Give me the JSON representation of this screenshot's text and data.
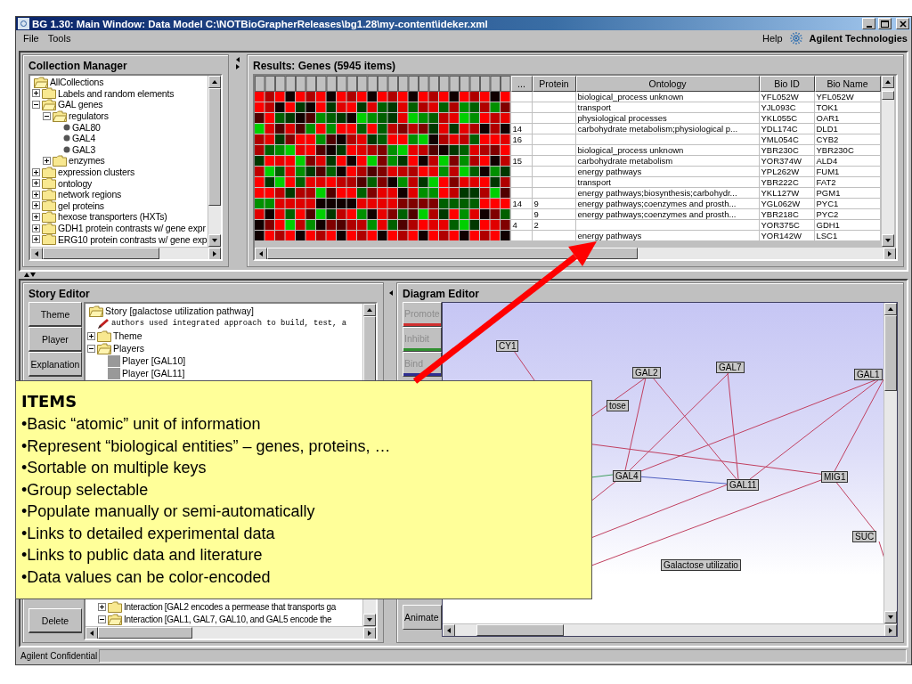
{
  "window": {
    "title": "BG 1.30: Main Window: Data Model C:\\NOTBioGrapherReleases\\bg1.28\\my-content\\ideker.xml"
  },
  "menu": [
    "File",
    "Tools"
  ],
  "menu_right": {
    "help": "Help",
    "brand": "Agilent Technologies"
  },
  "collection_manager": {
    "title": "Collection Manager",
    "tree": [
      {
        "label": "AllCollections",
        "kind": "root",
        "children": [
          {
            "label": "Labels and random elements",
            "kind": "folder",
            "expanded": false
          },
          {
            "label": "GAL genes",
            "kind": "folder",
            "expanded": true,
            "children": [
              {
                "label": "regulators",
                "kind": "folder",
                "expanded": true,
                "children": [
                  {
                    "label": "GAL80",
                    "kind": "gene"
                  },
                  {
                    "label": "GAL4",
                    "kind": "gene"
                  },
                  {
                    "label": "GAL3",
                    "kind": "gene"
                  }
                ]
              },
              {
                "label": "enzymes",
                "kind": "folder",
                "expanded": false
              }
            ]
          },
          {
            "label": "expression clusters",
            "kind": "folder",
            "expanded": false
          },
          {
            "label": "ontology",
            "kind": "folder",
            "expanded": false
          },
          {
            "label": "network regions",
            "kind": "folder",
            "expanded": false
          },
          {
            "label": "gel proteins",
            "kind": "folder",
            "expanded": false
          },
          {
            "label": "hexose transporters (HXTs)",
            "kind": "folder",
            "expanded": false
          },
          {
            "label": "GDH1 protein contrasts w/ gene expr",
            "kind": "folder",
            "expanded": false
          },
          {
            "label": "ERG10 protein contrasts w/ gene exp",
            "kind": "folder",
            "expanded": false
          }
        ]
      }
    ]
  },
  "results": {
    "title": "Results: Genes (5945 items)",
    "columns": [
      "...",
      "Protein",
      "Ontology",
      "Bio ID",
      "Bio Name"
    ],
    "rows": [
      [
        "",
        "",
        "biological_process unknown",
        "YFL052W",
        "YFL052W"
      ],
      [
        "",
        "",
        "transport",
        "YJL093C",
        "TOK1"
      ],
      [
        "",
        "",
        "physiological processes",
        "YKL055C",
        "OAR1"
      ],
      [
        "14",
        "",
        "carbohydrate metabolism;physiological p...",
        "YDL174C",
        "DLD1"
      ],
      [
        "16",
        "",
        "",
        "YML054C",
        "CYB2"
      ],
      [
        "",
        "",
        "biological_process unknown",
        "YBR230C",
        "YBR230C"
      ],
      [
        "15",
        "",
        "carbohydrate metabolism",
        "YOR374W",
        "ALD4"
      ],
      [
        "",
        "",
        "energy pathways",
        "YPL262W",
        "FUM1"
      ],
      [
        "",
        "",
        "transport",
        "YBR222C",
        "FAT2"
      ],
      [
        "",
        "",
        "energy pathways;biosynthesis;carbohydr...",
        "YKL127W",
        "PGM1"
      ],
      [
        "14",
        "9",
        "energy pathways;coenzymes and prosth...",
        "YGL062W",
        "PYC1"
      ],
      [
        "",
        "9",
        "energy pathways;coenzymes and prosth...",
        "YBR218C",
        "PYC2"
      ],
      [
        "4",
        "2",
        "",
        "YOR375C",
        "GDH1"
      ],
      [
        "",
        "",
        "energy pathways",
        "YOR142W",
        "LSC1"
      ]
    ]
  },
  "story_editor": {
    "title": "Story Editor",
    "buttons_top": [
      "Theme",
      "Player",
      "Explanation"
    ],
    "buttons_bottom": [
      "Delete"
    ],
    "tree_top": [
      {
        "label": "Story [galactose utilization pathway]",
        "kind": "root",
        "children": [
          {
            "label": "authors used integrated approach to build, test, a",
            "kind": "note"
          },
          {
            "label": "Theme",
            "kind": "folder",
            "expanded": false
          },
          {
            "label": "Players",
            "kind": "folder",
            "expanded": true,
            "children": [
              {
                "label": "Player [GAL10]",
                "kind": "player"
              },
              {
                "label": "Player [GAL11]",
                "kind": "player"
              }
            ]
          }
        ]
      }
    ],
    "tree_bottom": [
      {
        "label": "Interaction [GAL2 encodes a permease that transports ga",
        "kind": "folder",
        "expanded": false
      },
      {
        "label": "Interaction [GAL1, GAL7, GAL10, and GAL5 encode the",
        "kind": "folder",
        "expanded": true
      }
    ]
  },
  "diagram_editor": {
    "title": "Diagram Editor",
    "tools_top": [
      {
        "label": "Promote",
        "color": "#d03030",
        "disabled": true
      },
      {
        "label": "Inhibit",
        "color": "#309030",
        "disabled": true
      },
      {
        "label": "Bind",
        "color": "#303090",
        "disabled": true
      }
    ],
    "tools_bottom": [
      {
        "label": "Animate",
        "disabled": false
      }
    ],
    "nodes": [
      "CY1",
      "GAL2",
      "GAL7",
      "GAL1",
      "tose",
      "GAL4",
      "GAL11",
      "MIG1",
      "SUC",
      "Galactose utilizatio"
    ]
  },
  "callout": {
    "title": "ITEMS",
    "bullets": [
      "•Basic “atomic” unit of information",
      "•Represent “biological entities” – genes, proteins, …",
      "•Sortable on multiple keys",
      "•Group selectable",
      "•Populate manually or semi-automatically",
      "•Links to detailed experimental data",
      "•Links to public data and literature",
      "•Data values can be color-encoded"
    ]
  },
  "status_bar": {
    "text": "Agilent Confidential"
  }
}
